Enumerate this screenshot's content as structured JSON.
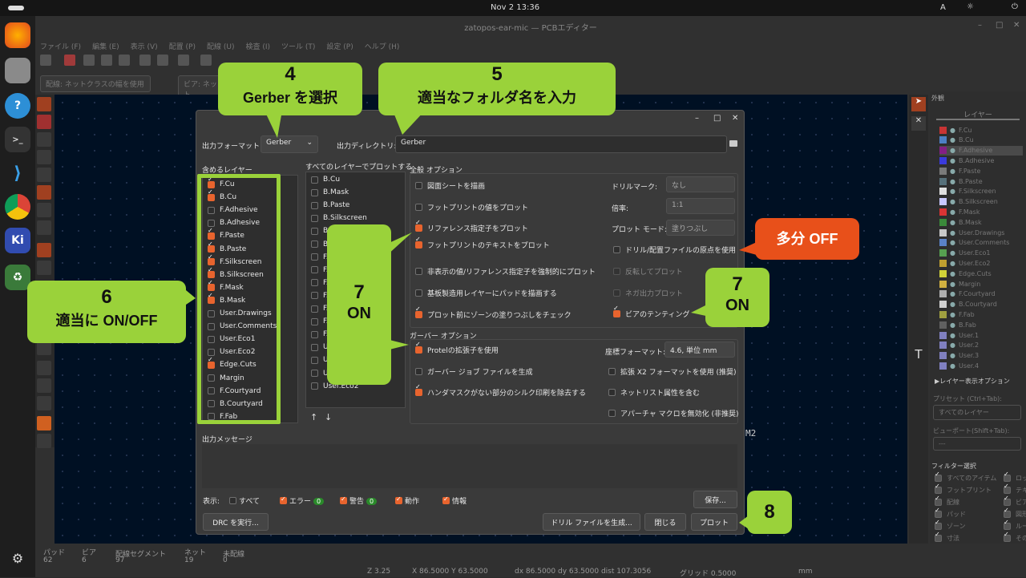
{
  "topbar": {
    "activities": "",
    "datetime": "Nov 2  13:36",
    "input_method": "A"
  },
  "window": {
    "title": "zatopos-ear-mic — PCBエディター"
  },
  "menu": [
    "ファイル (F)",
    "編集 (E)",
    "表示 (V)",
    "配置 (P)",
    "配線 (U)",
    "検査 (I)",
    "ツール (T)",
    "設定 (P)",
    "ヘルプ (H)"
  ],
  "track_select": "配線: ネットクラスの幅を使用",
  "via_select": "ビア: ネット",
  "right_panel": {
    "title": "外観",
    "tab": "レイヤー",
    "layer_options": "▶レイヤー表示オプション",
    "preset_label": "プリセット (Ctrl+Tab):",
    "preset_value": "すべてのレイヤー",
    "viewport_label": "ビューポート(Shift+Tab):",
    "viewport_value": "---",
    "filter_title": "フィルター選択",
    "layers": [
      "F.Cu",
      "B.Cu",
      "F.Adhesive",
      "B.Adhesive",
      "F.Paste",
      "B.Paste",
      "F.Silkscreen",
      "B.Silkscreen",
      "F.Mask",
      "B.Mask",
      "User.Drawings",
      "User.Comments",
      "User.Eco1",
      "User.Eco2",
      "Edge.Cuts",
      "Margin",
      "F.Courtyard",
      "B.Courtyard",
      "F.Fab",
      "B.Fab",
      "User.1",
      "User.2",
      "User.3",
      "User.4"
    ],
    "layer_colors": [
      "#c83434",
      "#4d7fc4",
      "#841f84",
      "#3a3adc",
      "#7a7a7a",
      "#56707a",
      "#e0e0e0",
      "#c8c8ff",
      "#d83434",
      "#3a8a3a",
      "#c8c8c8",
      "#5a82c8",
      "#56a050",
      "#c0a030",
      "#d0d238",
      "#d0b040",
      "#b0b0b0",
      "#d0d0d0",
      "#a0a040",
      "#606060",
      "#8080c0",
      "#8080c0",
      "#8080c0",
      "#8080c0"
    ],
    "filters": [
      [
        "すべてのアイテム",
        "ロック"
      ],
      [
        "フットプリント",
        "テキスト"
      ],
      [
        "配線",
        "ビア"
      ],
      [
        "パッド",
        "図形"
      ],
      [
        "ゾーン",
        "ルール"
      ],
      [
        "寸法",
        "その他"
      ]
    ]
  },
  "dialog": {
    "output_format_label": "出力フォーマット:",
    "output_format": "Gerber",
    "output_dir_label": "出力ディレクトリ:",
    "output_dir": "Gerber",
    "include_layers_title": "含めるレイヤー",
    "include_layers": [
      {
        "n": "F.Cu",
        "c": true
      },
      {
        "n": "B.Cu",
        "c": true
      },
      {
        "n": "F.Adhesive",
        "c": false
      },
      {
        "n": "B.Adhesive",
        "c": false
      },
      {
        "n": "F.Paste",
        "c": true
      },
      {
        "n": "B.Paste",
        "c": true
      },
      {
        "n": "F.Silkscreen",
        "c": true
      },
      {
        "n": "B.Silkscreen",
        "c": true
      },
      {
        "n": "F.Mask",
        "c": true
      },
      {
        "n": "B.Mask",
        "c": true
      },
      {
        "n": "User.Drawings",
        "c": false
      },
      {
        "n": "User.Comments",
        "c": false
      },
      {
        "n": "User.Eco1",
        "c": false
      },
      {
        "n": "User.Eco2",
        "c": false
      },
      {
        "n": "Edge.Cuts",
        "c": true
      },
      {
        "n": "Margin",
        "c": false
      },
      {
        "n": "F.Courtyard",
        "c": false
      },
      {
        "n": "B.Courtyard",
        "c": false
      },
      {
        "n": "F.Fab",
        "c": false
      }
    ],
    "all_layers_title": "すべてのレイヤーでプロットする",
    "all_layers": [
      "B.Cu",
      "B.Mask",
      "B.Paste",
      "B.Silkscreen",
      "B.A",
      "B",
      "F.",
      "F.",
      "F.",
      "F.",
      "F.",
      "F.",
      "F.",
      "U",
      "U",
      "User.",
      "User.Eco2"
    ],
    "general_title": "全般 オプション",
    "general_left": [
      {
        "t": "図面シートを描画",
        "c": false
      },
      {
        "t": "フットプリントの値をプロット",
        "c": false
      },
      {
        "t": "リファレンス指定子をプロット",
        "c": true
      },
      {
        "t": "フットプリントのテキストをプロット",
        "c": true
      },
      {
        "t": "非表示の値/リファレンス指定子を強制的にプロット",
        "c": false
      },
      {
        "t": "基板製造用レイヤーにパッドを描画する",
        "c": false
      },
      {
        "t": "プロット前にゾーンの塗りつぶしをチェック",
        "c": true
      }
    ],
    "drill_mark_label": "ドリルマーク:",
    "drill_mark": "なし",
    "scale_label": "倍率:",
    "scale": "1:1",
    "plot_mode_label": "プロット モード:",
    "plot_mode": "塗りつぶし",
    "general_right": [
      {
        "t": "ドリル/配置ファイルの原点を使用",
        "c": false
      },
      {
        "t": "反転してプロット",
        "c": false
      },
      {
        "t": "ネガ出力プロット",
        "c": false
      },
      {
        "t": "ビアのテンティング",
        "c": true
      }
    ],
    "gerber_title": "ガーバー オプション",
    "gerber_left": [
      {
        "t": "Protelの拡張子を使用",
        "c": true
      },
      {
        "t": "ガーバー ジョブ ファイルを生成",
        "c": false
      },
      {
        "t": "ハンダマスクがない部分のシルク印刷を除去する",
        "c": true
      }
    ],
    "coord_label": "座標フォーマット:",
    "coord": "4.6, 単位 mm",
    "gerber_right": [
      {
        "t": "拡張 X2 フォーマットを使用 (推奨)",
        "c": false
      },
      {
        "t": "ネットリスト属性を含む",
        "c": false
      },
      {
        "t": "アパーチャ マクロを無効化 (非推奨)",
        "c": false
      }
    ],
    "messages_title": "出力メッセージ",
    "show_label": "表示:",
    "f_all": "すべて",
    "f_err": "エラー",
    "f_err_n": "0",
    "f_warn": "警告",
    "f_warn_n": "0",
    "f_act": "動作",
    "f_info": "情報",
    "save_btn": "保存...",
    "drc_btn": "DRC を実行...",
    "drill_btn": "ドリル ファイルを生成...",
    "close_btn": "閉じる",
    "plot_btn": "プロット"
  },
  "callouts": {
    "c4n": "4",
    "c4t": "Gerber を選択",
    "c5n": "5",
    "c5t": "適当なフォルダ名を入力",
    "c6n": "6",
    "c6t": "適当に ON/OFF",
    "c7an": "7",
    "c7at": "ON",
    "c7bn": "7",
    "c7bt": "ON",
    "c8": "8",
    "off": "多分 OFF"
  },
  "status": {
    "pad_l": "パッド",
    "pad_v": "62",
    "via_l": "ビア",
    "via_v": "6",
    "seg_l": "配線セグメント",
    "seg_v": "97",
    "net_l": "ネット",
    "net_v": "19",
    "unr_l": "未配線",
    "unr_v": "0",
    "zoom": "Z 3.25",
    "xy": "X 86.5000  Y 63.5000",
    "dxy": "dx 86.5000  dy 63.5000  dist 107.3056",
    "grid": "グリッド 0.5000",
    "unit": "mm"
  },
  "canvas_label": "M2"
}
